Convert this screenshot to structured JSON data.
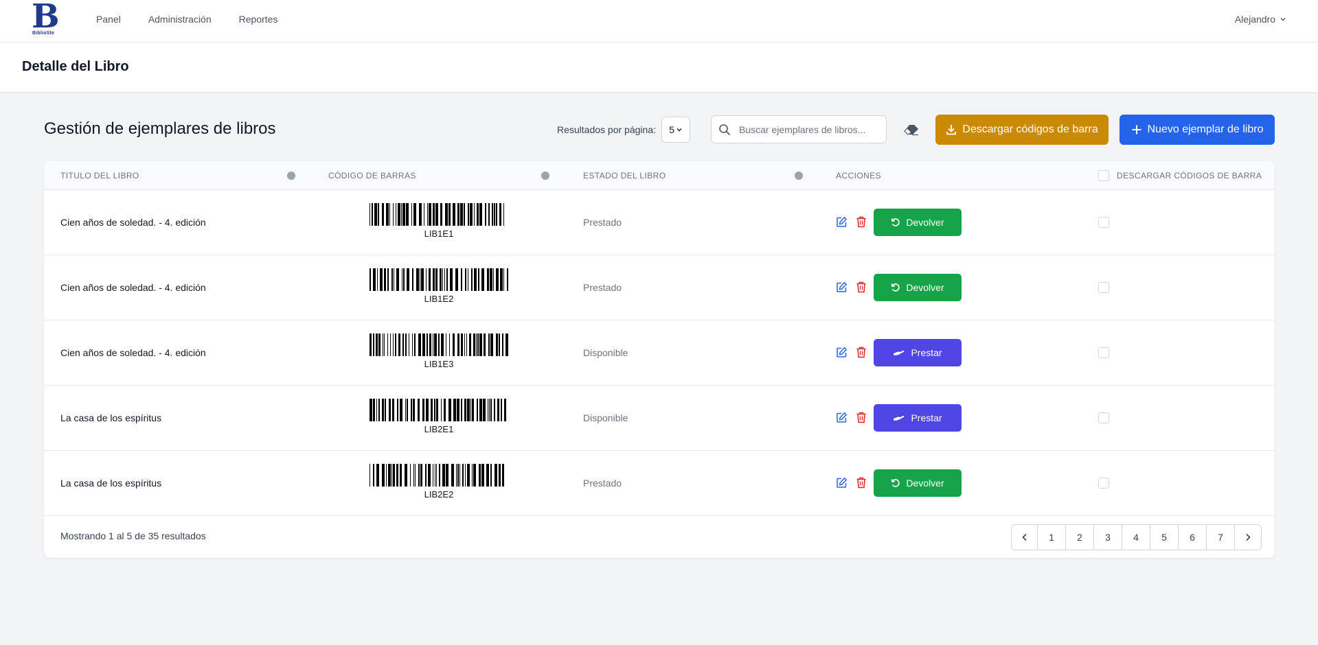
{
  "nav": {
    "logo_letter": "B",
    "logo_text": "BiblioSte",
    "links": [
      "Panel",
      "Administración",
      "Reportes"
    ],
    "user": "Alejandro"
  },
  "page": {
    "title": "Detalle del Libro"
  },
  "section": {
    "title": "Gestión de ejemplares de libros",
    "per_page_label": "Resultados por página:",
    "per_page_value": "5",
    "search_placeholder": "Buscar ejemplares de libros...",
    "download_label": "Descargar códigos de barra",
    "new_label": "Nuevo ejemplar de libro"
  },
  "table": {
    "headers": {
      "title": "TITULO DEL LIBRO",
      "barcode": "CÓDIGO DE BARRAS",
      "status": "ESTADO DEL LIBRO",
      "actions": "ACCIONES",
      "download": "DESCARGAR CÓDIGOS DE BARRA"
    },
    "rows": [
      {
        "title": "Cien años de soledad. - 4. edición",
        "code": "LIB1E1",
        "status": "Prestado",
        "action": "Devolver",
        "action_type": "devolver"
      },
      {
        "title": "Cien años de soledad. - 4. edición",
        "code": "LIB1E2",
        "status": "Prestado",
        "action": "Devolver",
        "action_type": "devolver"
      },
      {
        "title": "Cien años de soledad. - 4. edición",
        "code": "LIB1E3",
        "status": "Disponible",
        "action": "Prestar",
        "action_type": "prestar"
      },
      {
        "title": "La casa de los espíritus",
        "code": "LIB2E1",
        "status": "Disponible",
        "action": "Prestar",
        "action_type": "prestar"
      },
      {
        "title": "La casa de los espíritus",
        "code": "LIB2E2",
        "status": "Prestado",
        "action": "Devolver",
        "action_type": "devolver"
      }
    ]
  },
  "footer": {
    "showing": "Mostrando 1 al 5 de 35 resultados",
    "pages": [
      "1",
      "2",
      "3",
      "4",
      "5",
      "6",
      "7"
    ]
  },
  "colors": {
    "devolver": "#16a34a",
    "prestar": "#4f46e5",
    "download_button": "#ca8a04",
    "new_button": "#2563eb",
    "edit_icon": "#2563eb",
    "delete_icon": "#dc2626"
  },
  "icons": {
    "search": "search-icon",
    "eraser": "eraser-icon",
    "download": "download-icon",
    "plus": "plus-icon",
    "edit": "edit-icon",
    "delete": "trash-icon",
    "devolver": "undo-icon",
    "prestar": "hand-icon",
    "prev": "chevron-left-icon",
    "next": "chevron-right-icon",
    "user_menu": "chevron-down-icon"
  }
}
